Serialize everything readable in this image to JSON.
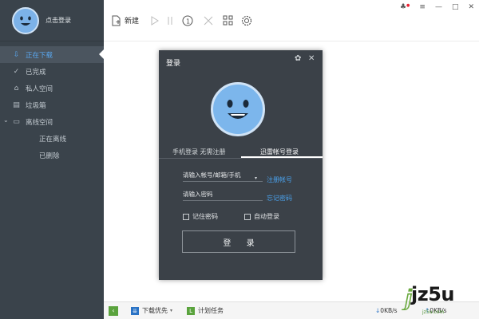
{
  "sidebar": {
    "login_label": "点击登录",
    "items": [
      {
        "label": "正在下载",
        "icon": "download-icon",
        "active": true
      },
      {
        "label": "已完成",
        "icon": "check-circle-icon"
      },
      {
        "label": "私人空间",
        "icon": "lock-icon"
      },
      {
        "label": "垃圾箱",
        "icon": "trash-icon"
      },
      {
        "label": "离线空间",
        "icon": "cloud-folder-icon"
      },
      {
        "label": "正在离线",
        "icon": ""
      },
      {
        "label": "已删除",
        "icon": ""
      }
    ]
  },
  "toolbar": {
    "new_label": "新建"
  },
  "dialog": {
    "title": "登录",
    "tabs": [
      "手机登录 无需注册",
      "迅雷帐号登录"
    ],
    "account_placeholder": "请输入帐号/邮箱/手机",
    "password_placeholder": "请输入密码",
    "register_link": "注册帐号",
    "forgot_link": "忘记密码",
    "remember_label": "记住密码",
    "auto_login_label": "自动登录",
    "login_button": "登 录"
  },
  "statusbar": {
    "download_priority": "下载优先",
    "schedule": "计划任务",
    "down_speed": "0KB/s",
    "up_speed": "0KB/s"
  },
  "watermark": {
    "text": "jz5u",
    "sub": "jz5u.com"
  },
  "colors": {
    "sidebar_bg": "#3a434b",
    "accent_blue": "#4aa3ef",
    "dialog_bg": "#3b4148",
    "avatar_blue": "#7cb6ec",
    "green": "#5aa33d"
  }
}
